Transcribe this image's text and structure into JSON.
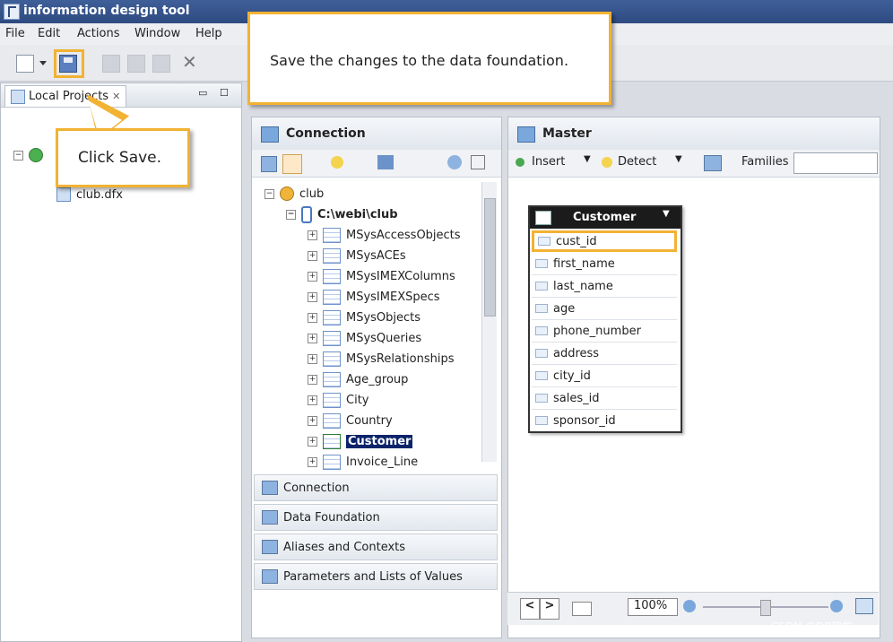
{
  "window": {
    "title": "information design tool"
  },
  "menu": [
    "File",
    "Edit",
    "Actions",
    "Window",
    "Help"
  ],
  "left_panel": {
    "tab_label": "Local Projects",
    "files": [
      "club.dfx"
    ]
  },
  "callouts": {
    "save_tip": "Save the changes to the data foundation.",
    "click_save": "Click Save."
  },
  "connection_panel": {
    "title": "Connection",
    "root": "club",
    "path": "C:\\webi\\club",
    "tables": [
      "MSysAccessObjects",
      "MSysACEs",
      "MSysIMEXColumns",
      "MSysIMEXSpecs",
      "MSysObjects",
      "MSysQueries",
      "MSysRelationships",
      "Age_group",
      "City",
      "Country",
      "Customer",
      "Invoice_Line"
    ],
    "selected": "Customer",
    "accordion": [
      "Connection",
      "Data Foundation",
      "Aliases and Contexts",
      "Parameters and Lists of Values"
    ]
  },
  "master_panel": {
    "title": "Master",
    "toolbar": {
      "insert": "Insert",
      "detect": "Detect",
      "families": "Families"
    },
    "zoom": "100%",
    "table": {
      "name": "Customer",
      "columns": [
        "cust_id",
        "first_name",
        "last_name",
        "age",
        "phone_number",
        "address",
        "city_id",
        "sales_id",
        "sponsor_id"
      ],
      "highlighted": "cust_id"
    }
  },
  "watermark": "CSDN @DB架构",
  "colors": {
    "accent": "#f2b233",
    "selection": "#0a246a"
  }
}
